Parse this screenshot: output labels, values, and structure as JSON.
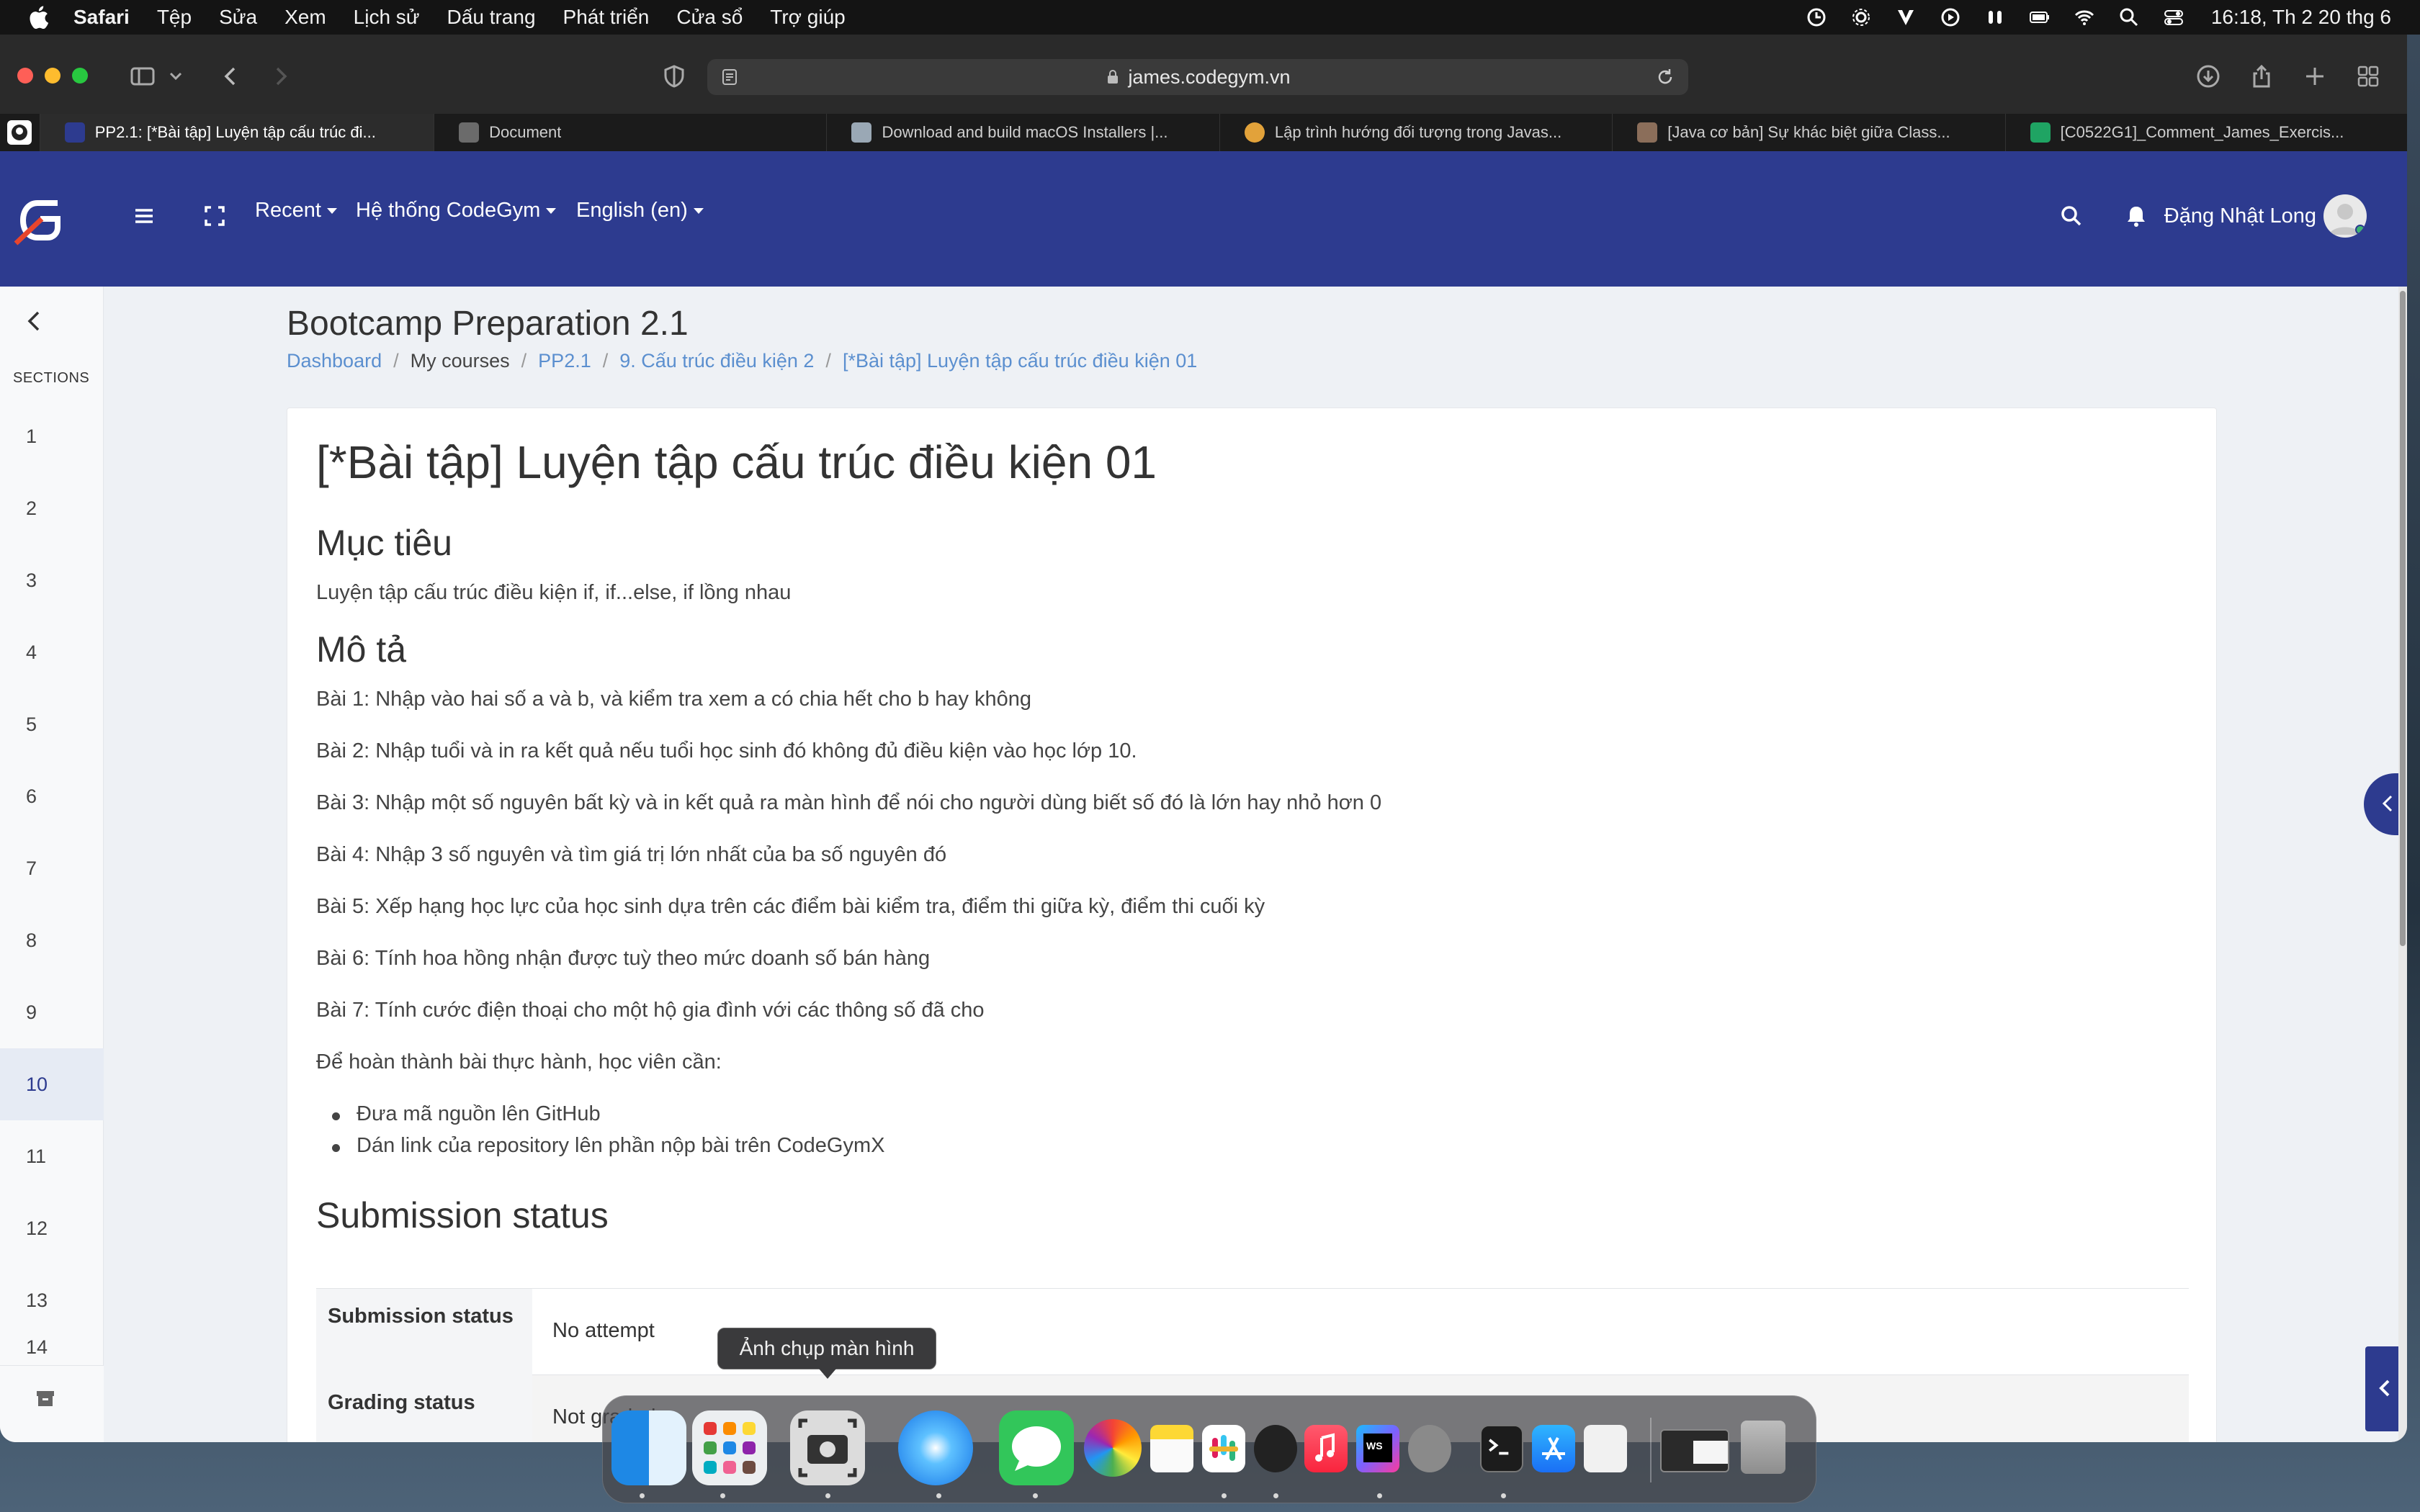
{
  "menubar": {
    "app": "Safari",
    "items": [
      "Tệp",
      "Sửa",
      "Xem",
      "Lịch sử",
      "Dấu trang",
      "Phát triển",
      "Cửa sổ",
      "Trợ giúp"
    ],
    "clock": "16:18, Th 2 20 thg 6"
  },
  "browser": {
    "url": "james.codegym.vn",
    "tabs": [
      {
        "title": "PP2.1: [*Bài tập] Luyện tập cấu trúc đi...",
        "favicon_color": "#2d3b8f"
      },
      {
        "title": "Document",
        "favicon_color": "#6b6b6b"
      },
      {
        "title": "Download and build macOS Installers |...",
        "favicon_color": "#9aa8b5"
      },
      {
        "title": "Lập trình hướng đối tượng trong Javas...",
        "favicon_color": "#e2a23a"
      },
      {
        "title": "[Java cơ bản] Sự khác biệt giữa Class...",
        "favicon_color": "#8b6e5a"
      },
      {
        "title": "[C0522G1]_Comment_James_Exercis...",
        "favicon_color": "#1fa463"
      }
    ]
  },
  "navbar": {
    "menus": [
      "Recent",
      "Hệ thống CodeGym",
      "English ‎(en)‎"
    ],
    "user_name": "Đặng Nhật Long",
    "brand_color": "#2d3b8f"
  },
  "drawer": {
    "sections_label": "SECTIONS",
    "items": [
      "1",
      "2",
      "3",
      "4",
      "5",
      "6",
      "7",
      "8",
      "9",
      "10",
      "11",
      "12",
      "13",
      "14"
    ],
    "active_index": 9
  },
  "page": {
    "course_title": "Bootcamp Preparation 2.1",
    "breadcrumb": [
      "Dashboard",
      "My courses",
      "PP2.1",
      "9. Cấu trúc điều kiện 2",
      "[*Bài tập] Luyện tập cấu trúc điều kiện 01"
    ],
    "title": "[*Bài tập] Luyện tập cấu trúc điều kiện 01",
    "objective_heading": "Mục tiêu",
    "objective_text": "Luyện tập cấu trúc điều kiện if, if...else, if lồng nhau",
    "description_heading": "Mô tả",
    "exercises": [
      "Bài 1: Nhập vào hai số a và b, và kiểm tra xem a có chia hết cho b hay không",
      "Bài 2: Nhập tuổi và in ra kết quả nếu tuổi học sinh đó không đủ điều kiện vào học lớp 10.",
      "Bài 3: Nhập một số nguyên bất kỳ và in kết quả ra màn hình để nói cho người dùng biết số đó là lớn hay nhỏ hơn 0",
      "Bài 4: Nhập 3 số nguyên và tìm giá trị lớn nhất của ba số nguyên đó",
      "Bài 5: Xếp hạng học lực của học sinh dựa trên các điểm bài kiểm tra, điểm thi giữa kỳ, điểm thi cuối kỳ",
      "Bài 6: Tính hoa hồng nhận được tuỳ theo mức doanh số bán hàng",
      "Bài 7: Tính cước điện thoại cho một hộ gia đình với các thông số đã cho"
    ],
    "completion_intro": "Để hoàn thành bài thực hành, học viên cần:",
    "completion_steps": [
      "Đưa mã nguồn lên GitHub",
      "Dán link của repository lên phần nộp bài trên CodeGymX"
    ],
    "submission_heading": "Submission status",
    "submission_rows": [
      {
        "label": "Submission status",
        "value": "No attempt"
      },
      {
        "label": "Grading status",
        "value": "Not graded"
      }
    ]
  },
  "dock": {
    "tooltip": "Ảnh chụp màn hình",
    "apps": [
      "finder-icon",
      "launchpad-icon",
      "screenshot-icon",
      "safari-icon",
      "messages-icon",
      "photos-icon",
      "notes-icon",
      "slack-icon",
      "logitech-icon",
      "music-icon",
      "webstorm-icon",
      "system-settings-icon",
      "terminal-icon",
      "app-store-icon",
      "script-editor-icon",
      "window-thumbnail-icon",
      "trash-icon"
    ]
  }
}
